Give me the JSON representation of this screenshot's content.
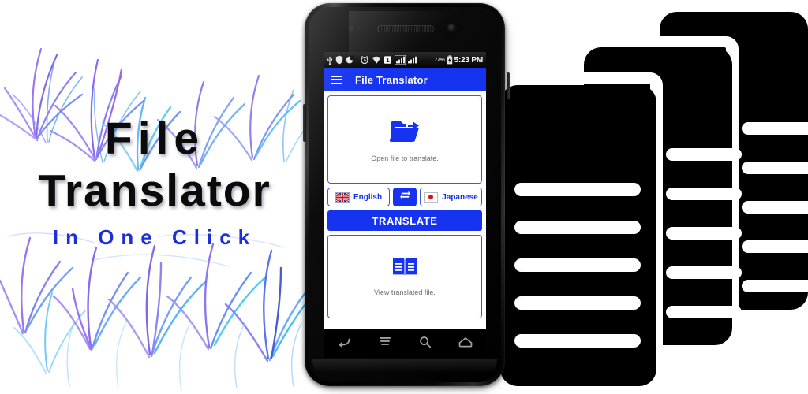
{
  "promo": {
    "headline_line1": "File",
    "headline_line2": "Translator",
    "tagline": "In One Click",
    "headline_color": "#0b0b0b",
    "tagline_color": "#1a2fd8",
    "background_color": "#ffffff"
  },
  "decoration": {
    "grass_art_name": "blue-purple-grass-illustration",
    "grass_colors": [
      "#7b4fe0",
      "#8f6cf0",
      "#5a7ff0",
      "#3fa9f5",
      "#33c3f0",
      "#9bd8f7",
      "#c3b4f7",
      "#2b3fd0"
    ],
    "document_stack_name": "document-stack-illustration",
    "document_fill": "#000000",
    "document_line_color": "#ffffff",
    "document_count": 3
  },
  "phone": {
    "device_name": "android-smartphone-mockup",
    "body_color": "#000000",
    "statusbar": {
      "icons": [
        "usb-icon",
        "shield-icon",
        "moon-icon",
        "alarm-icon",
        "wifi-icon",
        "sim1-icon",
        "signal-bars-icon",
        "signal-bars-2-icon"
      ],
      "battery_percent": "77%",
      "battery_icon": "battery-charging-icon",
      "clock": "5:23 PM"
    },
    "navbar": {
      "buttons": [
        "back-icon",
        "menu-icon",
        "search-icon",
        "home-icon"
      ]
    }
  },
  "app": {
    "accent_color": "#1633f0",
    "border_color": "#3b5bdb",
    "appbar": {
      "menu_icon": "hamburger-menu-icon",
      "title": "File Translator"
    },
    "open_card": {
      "icon": "folder-open-share-icon",
      "label": "Open file to translate."
    },
    "languages": {
      "source": {
        "flag": "uk-flag-icon",
        "name": "English"
      },
      "swap": {
        "icon": "swap-arrows-icon"
      },
      "target": {
        "flag": "japan-flag-icon",
        "name": "Japanese"
      }
    },
    "translate_button": {
      "label": "TRANSLATE"
    },
    "view_card": {
      "icon": "open-book-icon",
      "label": "View translated file."
    }
  }
}
